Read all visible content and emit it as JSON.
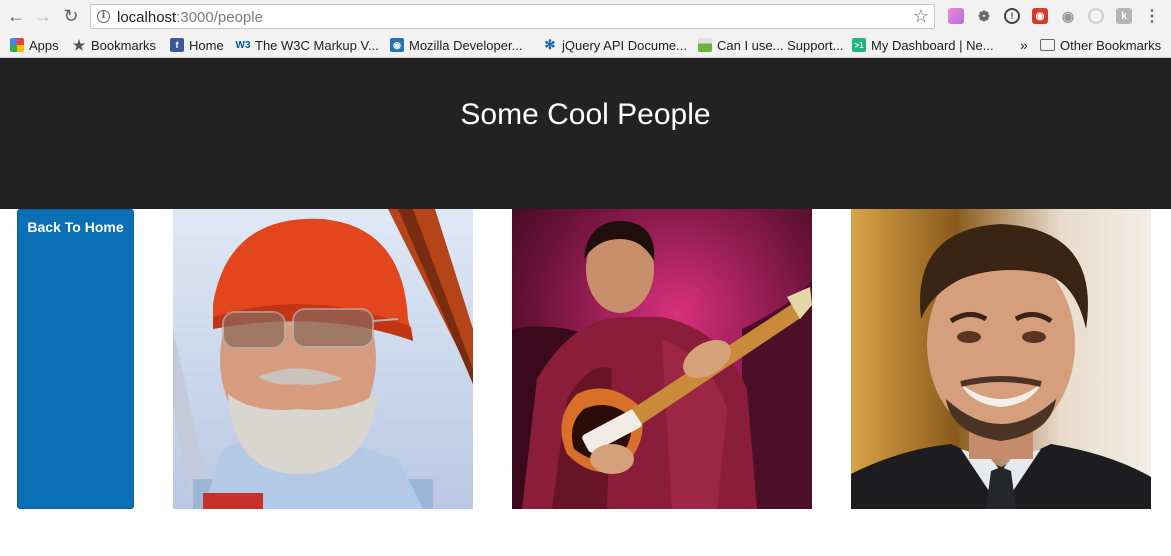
{
  "browser": {
    "url_host": "localhost",
    "url_path": ":3000/people",
    "bookmarks": [
      {
        "label": "Apps",
        "icon": "apps-grid-icon"
      },
      {
        "label": "Bookmarks",
        "icon": "star-icon"
      },
      {
        "label": "Home",
        "icon": "facebook-icon"
      },
      {
        "label": "The W3C Markup V...",
        "icon": "w3c-icon"
      },
      {
        "label": "Mozilla Developer...",
        "icon": "mozilla-icon"
      },
      {
        "label": "jQuery API Docume...",
        "icon": "jquery-icon"
      },
      {
        "label": "Can I use... Support...",
        "icon": "caniuse-icon"
      },
      {
        "label": "My Dashboard | Ne...",
        "icon": "dashboard-icon"
      }
    ],
    "overflow_label": "»",
    "other_bookmarks": "Other Bookmarks"
  },
  "page": {
    "title": "Some Cool People",
    "back_button": "Back To Home"
  },
  "people": [
    {
      "name": "person-with-red-beanie",
      "icon": "portrait-1"
    },
    {
      "name": "person-playing-guitar",
      "icon": "portrait-2"
    },
    {
      "name": "person-smiling-in-suit",
      "icon": "portrait-3"
    }
  ]
}
